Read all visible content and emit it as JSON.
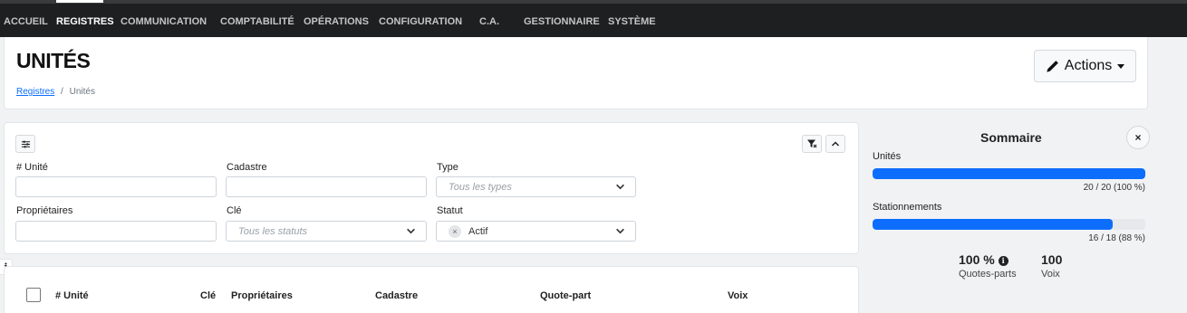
{
  "nav": {
    "items": [
      {
        "label": "ACCUEIL"
      },
      {
        "label": "REGISTRES"
      },
      {
        "label": "COMMUNICATION"
      },
      {
        "label": "COMPTABILITÉ"
      },
      {
        "label": "OPÉRATIONS"
      },
      {
        "label": "CONFIGURATION"
      },
      {
        "label": "C.A."
      },
      {
        "label": "GESTIONNAIRE"
      },
      {
        "label": "SYSTÈME"
      }
    ],
    "active": "REGISTRES"
  },
  "header": {
    "title": "UNITÉS",
    "breadcrumb": {
      "link": "Registres",
      "separator": "/",
      "current": "Unités"
    },
    "actions_label": "Actions"
  },
  "filters": {
    "unit_label": "# Unité",
    "cadastre_label": "Cadastre",
    "type_label": "Type",
    "type_placeholder": "Tous les types",
    "owners_label": "Propriétaires",
    "key_label": "Clé",
    "key_placeholder": "Tous les statuts",
    "status_label": "Statut",
    "status_value": "Actif",
    "status_clear": "×"
  },
  "summary": {
    "title": "Sommaire",
    "close": "×",
    "units_label": "Unités",
    "units_progress": 1.0,
    "units_stat": "20 / 20 (100 %)",
    "parking_label": "Stationnements",
    "parking_progress": 0.88,
    "parking_stat": "16 / 18 (88 %)",
    "quotes_value": "100 %",
    "quotes_label": "Quotes-parts",
    "votes_value": "100",
    "votes_label": "Voix"
  },
  "side_info": "i",
  "table": {
    "headers": [
      "# Unité",
      "Clé",
      "Propriétaires",
      "Cadastre",
      "Quote-part",
      "Voix"
    ]
  },
  "colors": {
    "nav_bg": "#1e1f20",
    "accent": "#0d6efd"
  }
}
